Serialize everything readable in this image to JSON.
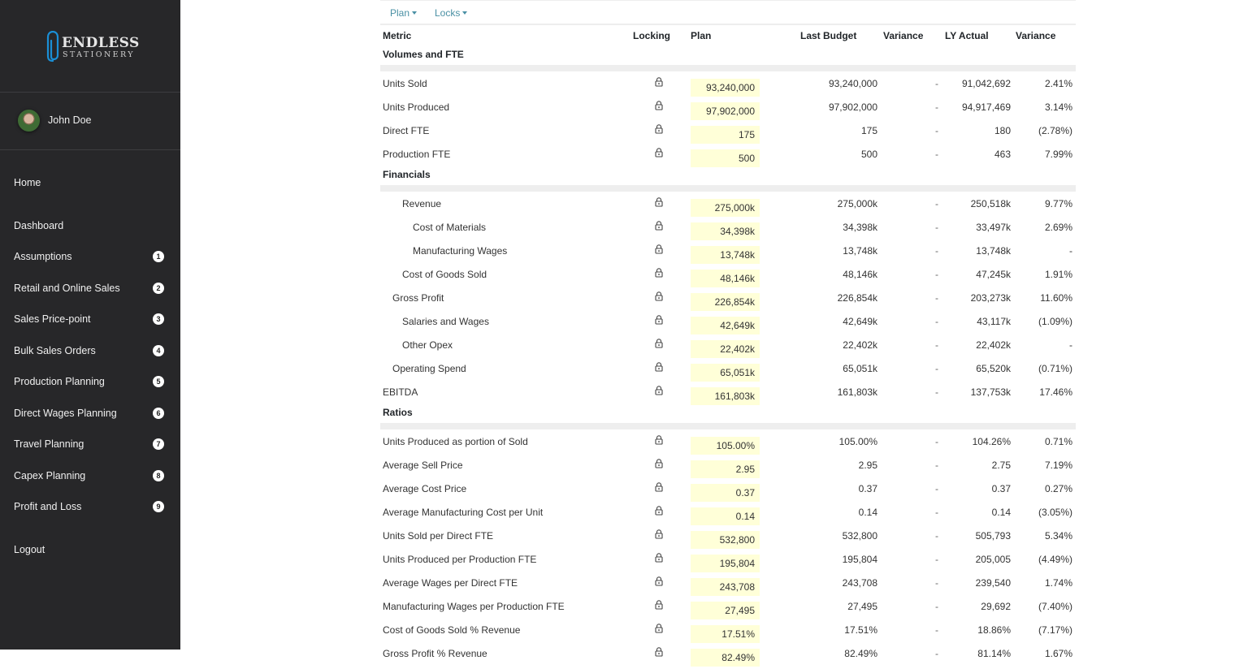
{
  "brand": {
    "line1": "ENDLESS",
    "line2": "STATIONERY",
    "accent": "#1a8fd6"
  },
  "user": {
    "name": "John Doe"
  },
  "nav": {
    "home": "Home",
    "items": [
      {
        "label": "Dashboard",
        "badge": null
      },
      {
        "label": "Assumptions",
        "badge": "1"
      },
      {
        "label": "Retail and Online Sales",
        "badge": "2"
      },
      {
        "label": "Sales Price-point",
        "badge": "3"
      },
      {
        "label": "Bulk Sales Orders",
        "badge": "4"
      },
      {
        "label": "Production Planning",
        "badge": "5"
      },
      {
        "label": "Direct Wages Planning",
        "badge": "6"
      },
      {
        "label": "Travel Planning",
        "badge": "7"
      },
      {
        "label": "Capex Planning",
        "badge": "8"
      },
      {
        "label": "Profit and Loss",
        "badge": "9"
      }
    ],
    "logout": "Logout"
  },
  "toolbar": {
    "plan_label": "Plan",
    "locks_label": "Locks"
  },
  "table": {
    "headers": {
      "metric": "Metric",
      "locking": "Locking",
      "plan": "Plan",
      "last_budget": "Last Budget",
      "variance1": "Variance",
      "ly_actual": "LY Actual",
      "variance2": "Variance"
    },
    "sections": [
      {
        "title": "Volumes and FTE",
        "rows": [
          {
            "metric": "Units Sold",
            "indent": 0,
            "plan": "93,240,000",
            "last_budget": "93,240,000",
            "variance1": "-",
            "ly_actual": "91,042,692",
            "variance2": "2.41%"
          },
          {
            "metric": "Units Produced",
            "indent": 0,
            "plan": "97,902,000",
            "last_budget": "97,902,000",
            "variance1": "-",
            "ly_actual": "94,917,469",
            "variance2": "3.14%"
          },
          {
            "metric": "Direct FTE",
            "indent": 0,
            "plan": "175",
            "last_budget": "175",
            "variance1": "-",
            "ly_actual": "180",
            "variance2": "(2.78%)"
          },
          {
            "metric": "Production FTE",
            "indent": 0,
            "plan": "500",
            "last_budget": "500",
            "variance1": "-",
            "ly_actual": "463",
            "variance2": "7.99%"
          }
        ]
      },
      {
        "title": "Financials",
        "rows": [
          {
            "metric": "Revenue",
            "indent": 2,
            "plan": "275,000k",
            "last_budget": "275,000k",
            "variance1": "-",
            "ly_actual": "250,518k",
            "variance2": "9.77%"
          },
          {
            "metric": "Cost of Materials",
            "indent": 3,
            "plan": "34,398k",
            "last_budget": "34,398k",
            "variance1": "-",
            "ly_actual": "33,497k",
            "variance2": "2.69%"
          },
          {
            "metric": "Manufacturing Wages",
            "indent": 3,
            "plan": "13,748k",
            "last_budget": "13,748k",
            "variance1": "-",
            "ly_actual": "13,748k",
            "variance2": "-"
          },
          {
            "metric": "Cost of Goods Sold",
            "indent": 2,
            "plan": "48,146k",
            "last_budget": "48,146k",
            "variance1": "-",
            "ly_actual": "47,245k",
            "variance2": "1.91%"
          },
          {
            "metric": "Gross Profit",
            "indent": 1,
            "plan": "226,854k",
            "last_budget": "226,854k",
            "variance1": "-",
            "ly_actual": "203,273k",
            "variance2": "11.60%"
          },
          {
            "metric": "Salaries and Wages",
            "indent": 2,
            "plan": "42,649k",
            "last_budget": "42,649k",
            "variance1": "-",
            "ly_actual": "43,117k",
            "variance2": "(1.09%)"
          },
          {
            "metric": "Other Opex",
            "indent": 2,
            "plan": "22,402k",
            "last_budget": "22,402k",
            "variance1": "-",
            "ly_actual": "22,402k",
            "variance2": "-"
          },
          {
            "metric": "Operating Spend",
            "indent": 1,
            "plan": "65,051k",
            "last_budget": "65,051k",
            "variance1": "-",
            "ly_actual": "65,520k",
            "variance2": "(0.71%)"
          },
          {
            "metric": "EBITDA",
            "indent": 0,
            "plan": "161,803k",
            "last_budget": "161,803k",
            "variance1": "-",
            "ly_actual": "137,753k",
            "variance2": "17.46%"
          }
        ]
      },
      {
        "title": "Ratios",
        "rows": [
          {
            "metric": "Units Produced as portion of Sold",
            "indent": 0,
            "plan": "105.00%",
            "last_budget": "105.00%",
            "variance1": "-",
            "ly_actual": "104.26%",
            "variance2": "0.71%"
          },
          {
            "metric": "Average Sell Price",
            "indent": 0,
            "plan": "2.95",
            "last_budget": "2.95",
            "variance1": "-",
            "ly_actual": "2.75",
            "variance2": "7.19%"
          },
          {
            "metric": "Average Cost Price",
            "indent": 0,
            "plan": "0.37",
            "last_budget": "0.37",
            "variance1": "-",
            "ly_actual": "0.37",
            "variance2": "0.27%"
          },
          {
            "metric": "Average Manufacturing Cost per Unit",
            "indent": 0,
            "plan": "0.14",
            "last_budget": "0.14",
            "variance1": "-",
            "ly_actual": "0.14",
            "variance2": "(3.05%)"
          },
          {
            "metric": "Units Sold per Direct FTE",
            "indent": 0,
            "plan": "532,800",
            "last_budget": "532,800",
            "variance1": "-",
            "ly_actual": "505,793",
            "variance2": "5.34%"
          },
          {
            "metric": "Units Produced per Production FTE",
            "indent": 0,
            "plan": "195,804",
            "last_budget": "195,804",
            "variance1": "-",
            "ly_actual": "205,005",
            "variance2": "(4.49%)"
          },
          {
            "metric": "Average Wages per Direct FTE",
            "indent": 0,
            "plan": "243,708",
            "last_budget": "243,708",
            "variance1": "-",
            "ly_actual": "239,540",
            "variance2": "1.74%"
          },
          {
            "metric": "Manufacturing Wages per Production FTE",
            "indent": 0,
            "plan": "27,495",
            "last_budget": "27,495",
            "variance1": "-",
            "ly_actual": "29,692",
            "variance2": "(7.40%)"
          },
          {
            "metric": "Cost of Goods Sold % Revenue",
            "indent": 0,
            "plan": "17.51%",
            "last_budget": "17.51%",
            "variance1": "-",
            "ly_actual": "18.86%",
            "variance2": "(7.17%)"
          },
          {
            "metric": "Gross Profit % Revenue",
            "indent": 0,
            "plan": "82.49%",
            "last_budget": "82.49%",
            "variance1": "-",
            "ly_actual": "81.14%",
            "variance2": "1.67%"
          }
        ]
      }
    ]
  }
}
